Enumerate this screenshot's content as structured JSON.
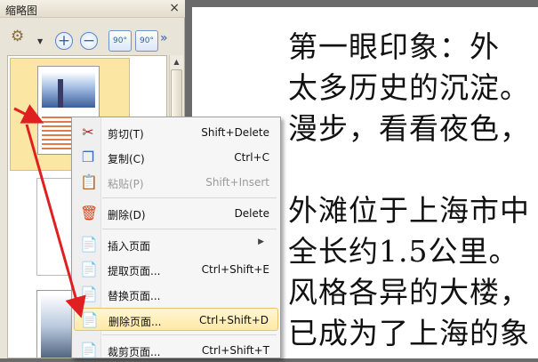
{
  "panel": {
    "title": "缩略图",
    "close_glyph": "×",
    "toolbar": {
      "settings_icon": "gear-icon",
      "zoom_in_glyph": "+",
      "zoom_out_glyph": "−",
      "rotate_left_label": "90°",
      "rotate_right_label": "90°",
      "more_glyph": "»"
    }
  },
  "document": {
    "lines": [
      "第一眼印象：外",
      "太多历史的沉淀。",
      "漫步，看看夜色，",
      "外滩位于上海市中",
      "全长约1.5公里。",
      "风格各异的大楼，",
      "已成为了上海的象"
    ]
  },
  "context_menu": {
    "items": [
      {
        "label": "剪切(T)",
        "shortcut": "Shift+Delete",
        "icon": "scissors-icon",
        "enabled": true
      },
      {
        "label": "复制(C)",
        "shortcut": "Ctrl+C",
        "icon": "copy-icon",
        "enabled": true
      },
      {
        "label": "粘贴(P)",
        "shortcut": "Shift+Insert",
        "icon": "paste-icon",
        "enabled": false
      },
      {
        "label": "删除(D)",
        "shortcut": "Delete",
        "icon": "trash-icon",
        "enabled": true
      },
      {
        "label": "插入页面",
        "shortcut": "",
        "icon": "insert-page-icon",
        "enabled": true,
        "submenu": true
      },
      {
        "label": "提取页面...",
        "shortcut": "Ctrl+Shift+E",
        "icon": "extract-page-icon",
        "enabled": true
      },
      {
        "label": "替换页面...",
        "shortcut": "",
        "icon": "replace-page-icon",
        "enabled": true
      },
      {
        "label": "删除页面...",
        "shortcut": "Ctrl+Shift+D",
        "icon": "delete-page-icon",
        "enabled": true,
        "highlighted": true
      },
      {
        "label": "裁剪页面...",
        "shortcut": "Ctrl+Shift+T",
        "icon": "crop-page-icon",
        "enabled": true
      }
    ],
    "submenu_glyph": "▶"
  },
  "colors": {
    "highlight": "#ffe9a6",
    "annotation_arrow": "#e02020",
    "panel_bg": "#e9e4d8"
  }
}
